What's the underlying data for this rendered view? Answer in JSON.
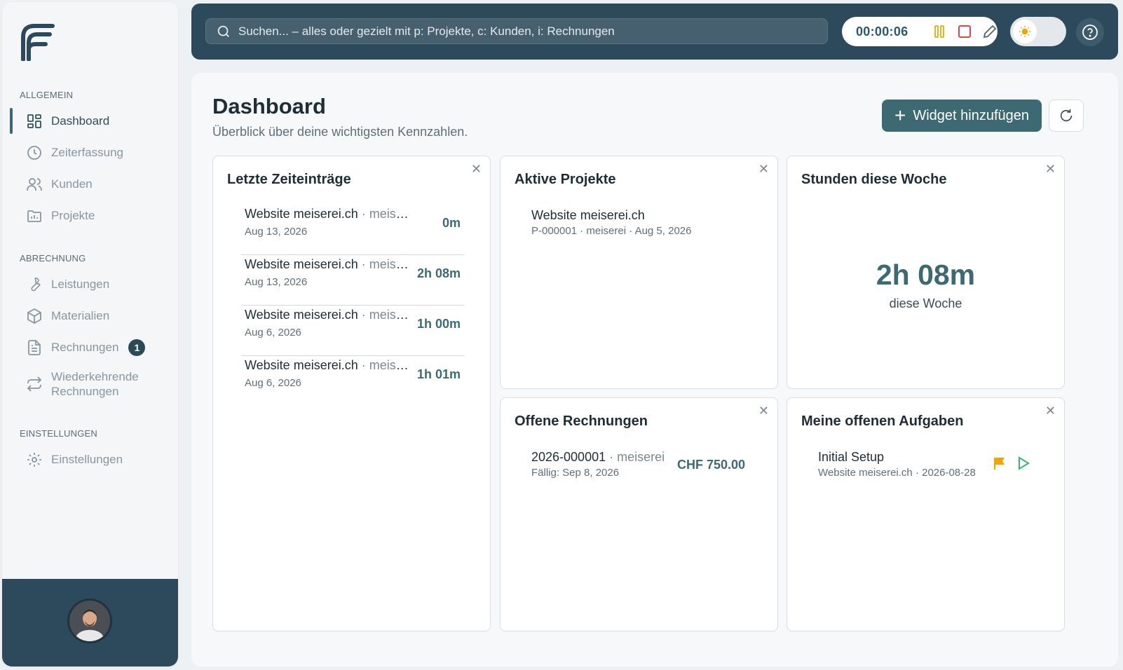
{
  "sidebar": {
    "sections": [
      {
        "heading": "ALLGEMEIN",
        "items": [
          {
            "label": "Dashboard",
            "icon": "dashboard-grid-icon"
          },
          {
            "label": "Zeiterfassung",
            "icon": "clock-icon"
          },
          {
            "label": "Kunden",
            "icon": "users-icon"
          },
          {
            "label": "Projekte",
            "icon": "folder-chart-icon"
          }
        ]
      },
      {
        "heading": "ABRECHNUNG",
        "items": [
          {
            "label": "Leistungen",
            "icon": "wrench-icon"
          },
          {
            "label": "Materialien",
            "icon": "package-icon"
          },
          {
            "label": "Rechnungen",
            "icon": "document-icon",
            "badge": "1"
          },
          {
            "label": "Wiederkehrende Rechnungen",
            "icon": "repeat-icon"
          }
        ]
      },
      {
        "heading": "EINSTELLUNGEN",
        "items": [
          {
            "label": "Einstellungen",
            "icon": "gear-icon"
          }
        ]
      }
    ]
  },
  "topbar": {
    "search_placeholder": "Suchen... – alles oder gezielt mit p: Projekte, c: Kunden, i: Rechnungen",
    "timer": "00:00:06"
  },
  "colors": {
    "brand": "#2c4a5c",
    "accent": "#3d6a72",
    "pause": "#e6b422",
    "stop": "#e04444",
    "flag": "#f0a500",
    "play": "#3cb371"
  },
  "main": {
    "title": "Dashboard",
    "subtitle": "Überblick über deine wichtigsten Kennzahlen.",
    "add_widget_label": "Widget hinzufügen",
    "widgets": {
      "time_entries": {
        "title": "Letzte Zeiteinträge",
        "entries": [
          {
            "project": "Website meiserei.ch",
            "customer": " · meiserei",
            "date": "Aug 13, 2026",
            "duration": "0m"
          },
          {
            "project": "Website meiserei.ch",
            "customer": " · meiserei",
            "date": "Aug 13, 2026",
            "duration": "2h 08m"
          },
          {
            "project": "Website meiserei.ch",
            "customer": " · meiserei",
            "date": "Aug 6, 2026",
            "duration": "1h 00m"
          },
          {
            "project": "Website meiserei.ch",
            "customer": " · meiserei",
            "date": "Aug 6, 2026",
            "duration": "1h 01m"
          }
        ]
      },
      "active_projects": {
        "title": "Aktive Projekte",
        "name": "Website meiserei.ch",
        "meta": "P-000001 · meiserei · Aug 5, 2026"
      },
      "hours_week": {
        "title": "Stunden diese Woche",
        "value": "2h 08m",
        "label": "diese Woche"
      },
      "open_invoices": {
        "title": "Offene Rechnungen",
        "number": "2026-000001",
        "customer": " · meiserei",
        "due": "Fällig: Sep 8, 2026",
        "amount": "CHF 750.00"
      },
      "open_tasks": {
        "title": "Meine offenen Aufgaben",
        "name": "Initial Setup",
        "meta": "Website meiserei.ch · 2026-08-28"
      }
    }
  }
}
